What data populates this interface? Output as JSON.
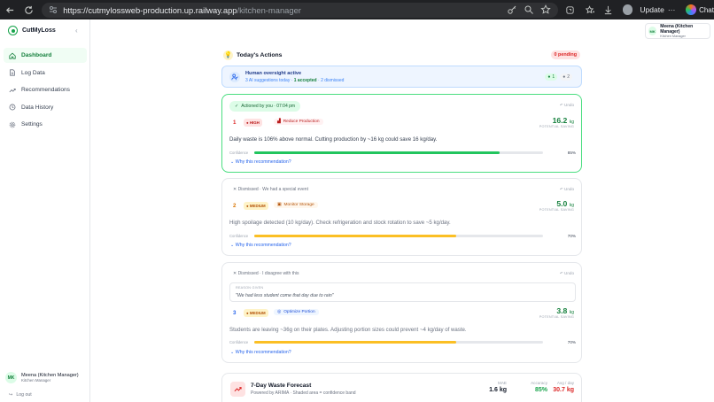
{
  "browser": {
    "url_host": "https://cutmylossweb-production.up.railway.app",
    "url_path": "/kitchen-manager",
    "update_label": "Update",
    "chat_label": "Chat"
  },
  "sidebar": {
    "brand": "CutMyLoss",
    "collapse": "‹",
    "items": [
      {
        "label": "Dashboard",
        "icon": "home-icon",
        "active": true
      },
      {
        "label": "Log Data",
        "icon": "document-icon"
      },
      {
        "label": "Recommendations",
        "icon": "trend-icon"
      },
      {
        "label": "Data History",
        "icon": "history-icon"
      },
      {
        "label": "Settings",
        "icon": "gear-icon"
      }
    ],
    "user": {
      "initials": "MK",
      "name": "Meena (Kitchen Manager)",
      "role": "Kitchen Manager"
    },
    "logout": "Log out"
  },
  "header_user": {
    "initials": "MK",
    "name": "Meena (Kitchen Manager)",
    "role": "Kitchen Manager"
  },
  "actions": {
    "title": "Today's Actions",
    "pending": "0 pending",
    "oversight": {
      "title": "Human oversight active",
      "summary_prefix": "3 AI suggestions today · ",
      "accepted_text": "1 accepted",
      "summary_suffix": " · 2 dismissed",
      "accepted_count": "1",
      "dismissed_count": "2"
    },
    "cards": [
      {
        "status": "Actioned by you · 07:04 pm",
        "undo": "Undo",
        "rank": "1",
        "priority": "HIGH",
        "action": "Reduce Production",
        "saving": "16.2",
        "unit": "kg",
        "saving_label": "POTENTIAL SAVING",
        "description": "Daily waste is 106% above normal. Cutting production by ~16 kg could save 16 kg/day.",
        "confidence_label": "Confidence",
        "confidence": 85,
        "confidence_text": "85%",
        "why": "Why this recommendation?"
      },
      {
        "status": "Dismissed · We had a special event",
        "undo": "Undo",
        "rank": "2",
        "priority": "MEDIUM",
        "action": "Monitor Storage",
        "saving": "5.0",
        "unit": "kg",
        "saving_label": "POTENTIAL SAVING",
        "description": "High spoilage detected (10 kg/day). Check refrigeration and stock rotation to save ~5 kg/day.",
        "confidence_label": "Confidence",
        "confidence": 70,
        "confidence_text": "70%",
        "why": "Why this recommendation?"
      },
      {
        "status": "Dismissed · I disagree with this",
        "undo": "Undo",
        "reason_label": "REASON GIVEN",
        "reason": "\"We had less student come that day due to rain\"",
        "rank": "3",
        "priority": "MEDIUM",
        "action": "Optimize Portion",
        "saving": "3.8",
        "unit": "kg",
        "saving_label": "POTENTIAL SAVING",
        "description": "Students are leaving ~36g on their plates. Adjusting portion sizes could prevent ~4 kg/day of waste.",
        "confidence_label": "Confidence",
        "confidence": 70,
        "confidence_text": "70%",
        "why": "Why this recommendation?"
      }
    ]
  },
  "forecast": {
    "title": "7-Day Waste Forecast",
    "subtitle": "Powered by ARIMA · Shaded area = confidence band",
    "mae_label": "MAE",
    "mae": "1.6 kg",
    "accuracy_label": "Accuracy",
    "accuracy": "85%",
    "avg_label": "Avg / day",
    "avg": "30.7 kg"
  },
  "colors": {
    "brand": "#16a34a",
    "accepted_border": "#4ade80",
    "high_bar": "#22c55e",
    "medium_bar": "#fbbf24",
    "link": "#2563eb"
  }
}
